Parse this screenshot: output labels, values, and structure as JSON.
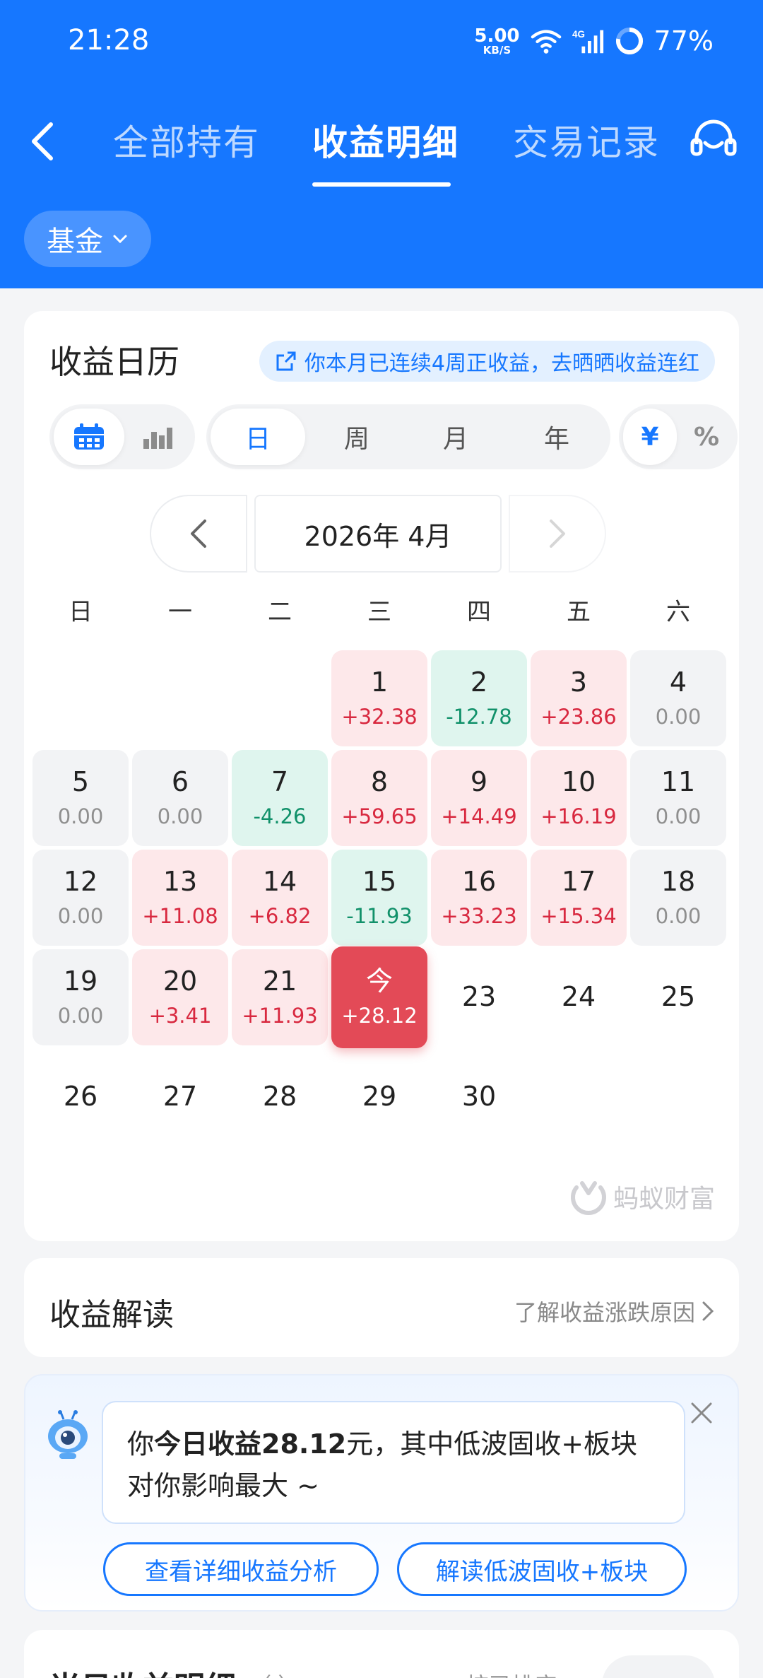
{
  "status_bar": {
    "time": "21:28",
    "net_speed_value": "5.00",
    "net_speed_unit": "KB/S",
    "network_label": "4G",
    "battery": "77%"
  },
  "nav": {
    "tabs": [
      {
        "label": "全部持有",
        "active": false
      },
      {
        "label": "收益明细",
        "active": true
      },
      {
        "label": "交易记录",
        "active": false
      }
    ],
    "filter_label": "基金"
  },
  "calendar": {
    "title": "收益日历",
    "streak_text": "你本月已连续4周正收益，去晒晒收益连红",
    "period_tabs": [
      "日",
      "周",
      "月",
      "年"
    ],
    "active_period": "日",
    "unit_tabs": [
      "¥",
      "%"
    ],
    "active_unit": "¥",
    "month_label": "2026年 4月",
    "weekdays": [
      "日",
      "一",
      "二",
      "三",
      "四",
      "五",
      "六"
    ],
    "first_weekday_index": 3,
    "days": [
      {
        "n": "1",
        "v": "+32.38",
        "t": "pos"
      },
      {
        "n": "2",
        "v": "-12.78",
        "t": "neg"
      },
      {
        "n": "3",
        "v": "+23.86",
        "t": "pos"
      },
      {
        "n": "4",
        "v": "0.00",
        "t": "zero"
      },
      {
        "n": "5",
        "v": "0.00",
        "t": "zero"
      },
      {
        "n": "6",
        "v": "0.00",
        "t": "zero"
      },
      {
        "n": "7",
        "v": "-4.26",
        "t": "neg"
      },
      {
        "n": "8",
        "v": "+59.65",
        "t": "pos"
      },
      {
        "n": "9",
        "v": "+14.49",
        "t": "pos"
      },
      {
        "n": "10",
        "v": "+16.19",
        "t": "pos"
      },
      {
        "n": "11",
        "v": "0.00",
        "t": "zero"
      },
      {
        "n": "12",
        "v": "0.00",
        "t": "zero"
      },
      {
        "n": "13",
        "v": "+11.08",
        "t": "pos"
      },
      {
        "n": "14",
        "v": "+6.82",
        "t": "pos"
      },
      {
        "n": "15",
        "v": "-11.93",
        "t": "neg"
      },
      {
        "n": "16",
        "v": "+33.23",
        "t": "pos"
      },
      {
        "n": "17",
        "v": "+15.34",
        "t": "pos"
      },
      {
        "n": "18",
        "v": "0.00",
        "t": "zero"
      },
      {
        "n": "19",
        "v": "0.00",
        "t": "zero"
      },
      {
        "n": "20",
        "v": "+3.41",
        "t": "pos"
      },
      {
        "n": "21",
        "v": "+11.93",
        "t": "pos"
      },
      {
        "n": "今",
        "v": "+28.12",
        "t": "today"
      },
      {
        "n": "23",
        "v": "",
        "t": "empty"
      },
      {
        "n": "24",
        "v": "",
        "t": "empty"
      },
      {
        "n": "25",
        "v": "",
        "t": "empty"
      },
      {
        "n": "26",
        "v": "",
        "t": "empty"
      },
      {
        "n": "27",
        "v": "",
        "t": "empty"
      },
      {
        "n": "28",
        "v": "",
        "t": "empty"
      },
      {
        "n": "29",
        "v": "",
        "t": "empty"
      },
      {
        "n": "30",
        "v": "",
        "t": "empty"
      }
    ],
    "brand": "蚂蚁财富"
  },
  "interpret": {
    "title": "收益解读",
    "link": "了解收益涨跌原因"
  },
  "ai_tip": {
    "prefix": "你",
    "bold": "今日收益28.12",
    "suffix": "元，其中低波固收+板块对你影响最大 ~",
    "button1": "查看详细收益分析",
    "button2": "解读低波固收+板块"
  },
  "bottom": {
    "title": "当日收益明细",
    "sub": "（ ）",
    "sort": "按已排序"
  },
  "colors": {
    "brand_blue": "#1677ff",
    "positive": "#d8283f",
    "negative": "#11916a",
    "today_bg": "#e34a57"
  }
}
